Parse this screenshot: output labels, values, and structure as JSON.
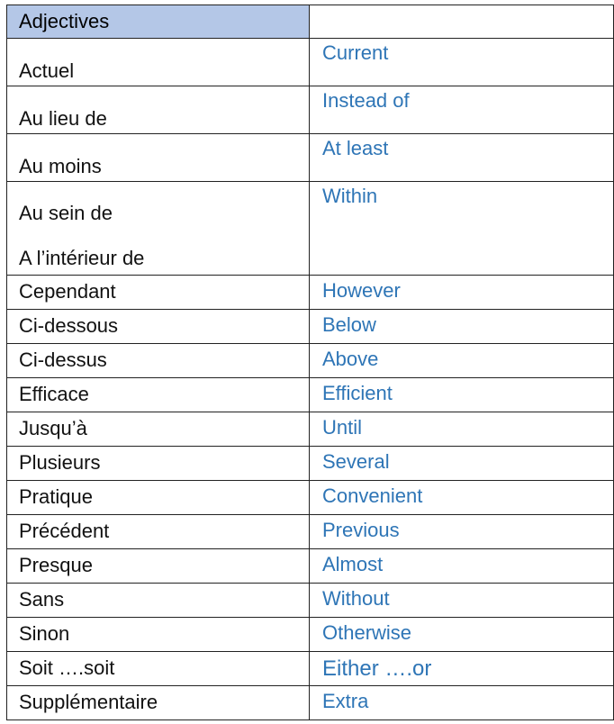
{
  "table": {
    "header": {
      "left": "Adjectives",
      "right": ""
    },
    "rows": [
      {
        "fr": [
          "Actuel"
        ],
        "en": "Current"
      },
      {
        "fr": [
          "Au lieu de"
        ],
        "en": "Instead of"
      },
      {
        "fr": [
          "Au moins"
        ],
        "en": "At least"
      },
      {
        "fr": [
          "Au sein de",
          "A l’intérieur de"
        ],
        "en": "Within"
      },
      {
        "fr": [
          "Cependant"
        ],
        "en": "However"
      },
      {
        "fr": [
          "Ci-dessous"
        ],
        "en": "Below"
      },
      {
        "fr": [
          "Ci-dessus"
        ],
        "en": "Above"
      },
      {
        "fr": [
          "Efficace"
        ],
        "en": "Efficient"
      },
      {
        "fr": [
          "Jusqu’à"
        ],
        "en": "Until"
      },
      {
        "fr": [
          "Plusieurs"
        ],
        "en": "Several"
      },
      {
        "fr": [
          "Pratique"
        ],
        "en": "Convenient"
      },
      {
        "fr": [
          "Précédent"
        ],
        "en": "Previous"
      },
      {
        "fr": [
          "Presque"
        ],
        "en": "Almost"
      },
      {
        "fr": [
          "Sans"
        ],
        "en": "Without"
      },
      {
        "fr": [
          "Sinon"
        ],
        "en": "Otherwise"
      },
      {
        "fr": [
          "Soit ….soit"
        ],
        "en": "Either ….or"
      },
      {
        "fr": [
          "Supplémentaire"
        ],
        "en": "Extra"
      }
    ]
  },
  "colors": {
    "header_bg": "#b4c7e7",
    "english_text": "#2e75b6",
    "border": "#222222"
  }
}
